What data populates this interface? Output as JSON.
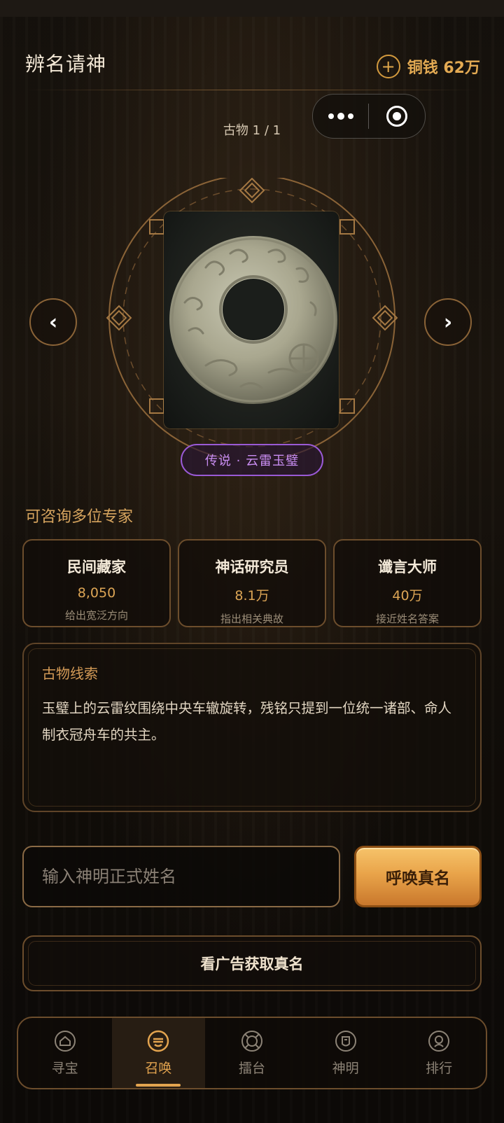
{
  "header": {
    "title": "辨名请神",
    "coins": "铜钱 62万",
    "add_symbol": "+"
  },
  "artifact": {
    "counter": "古物 1 / 1",
    "rarity_label": "传说 · 云雷玉璧",
    "prev_symbol": "‹",
    "next_symbol": "›"
  },
  "experts": {
    "section_title": "可咨询多位专家",
    "items": [
      {
        "name": "民间藏家",
        "price": "8,050",
        "desc": "给出宽泛方向"
      },
      {
        "name": "神话研究员",
        "price": "8.1万",
        "desc": "指出相关典故"
      },
      {
        "name": "谶言大师",
        "price": "40万",
        "desc": "接近姓名答案"
      }
    ]
  },
  "clue": {
    "title": "古物线索",
    "text": "玉璧上的云雷纹围绕中央车辙旋转，残铭只提到一位统一诸部、命人制衣冠舟车的共主。"
  },
  "input": {
    "placeholder": "输入神明正式姓名",
    "value": ""
  },
  "buttons": {
    "summon": "呼唤真名",
    "ad": "看广告获取真名"
  },
  "tabs": [
    {
      "label": "寻宝",
      "icon": "home-icon",
      "active": false
    },
    {
      "label": "召唤",
      "icon": "summon-icon",
      "active": true
    },
    {
      "label": "擂台",
      "icon": "arena-icon",
      "active": false
    },
    {
      "label": "神明",
      "icon": "deity-icon",
      "active": false
    },
    {
      "label": "排行",
      "icon": "rank-icon",
      "active": false
    }
  ],
  "colors": {
    "accent": "#e3a44f",
    "legend_purple": "#9a5ad6",
    "border": "#6c4d2c"
  }
}
